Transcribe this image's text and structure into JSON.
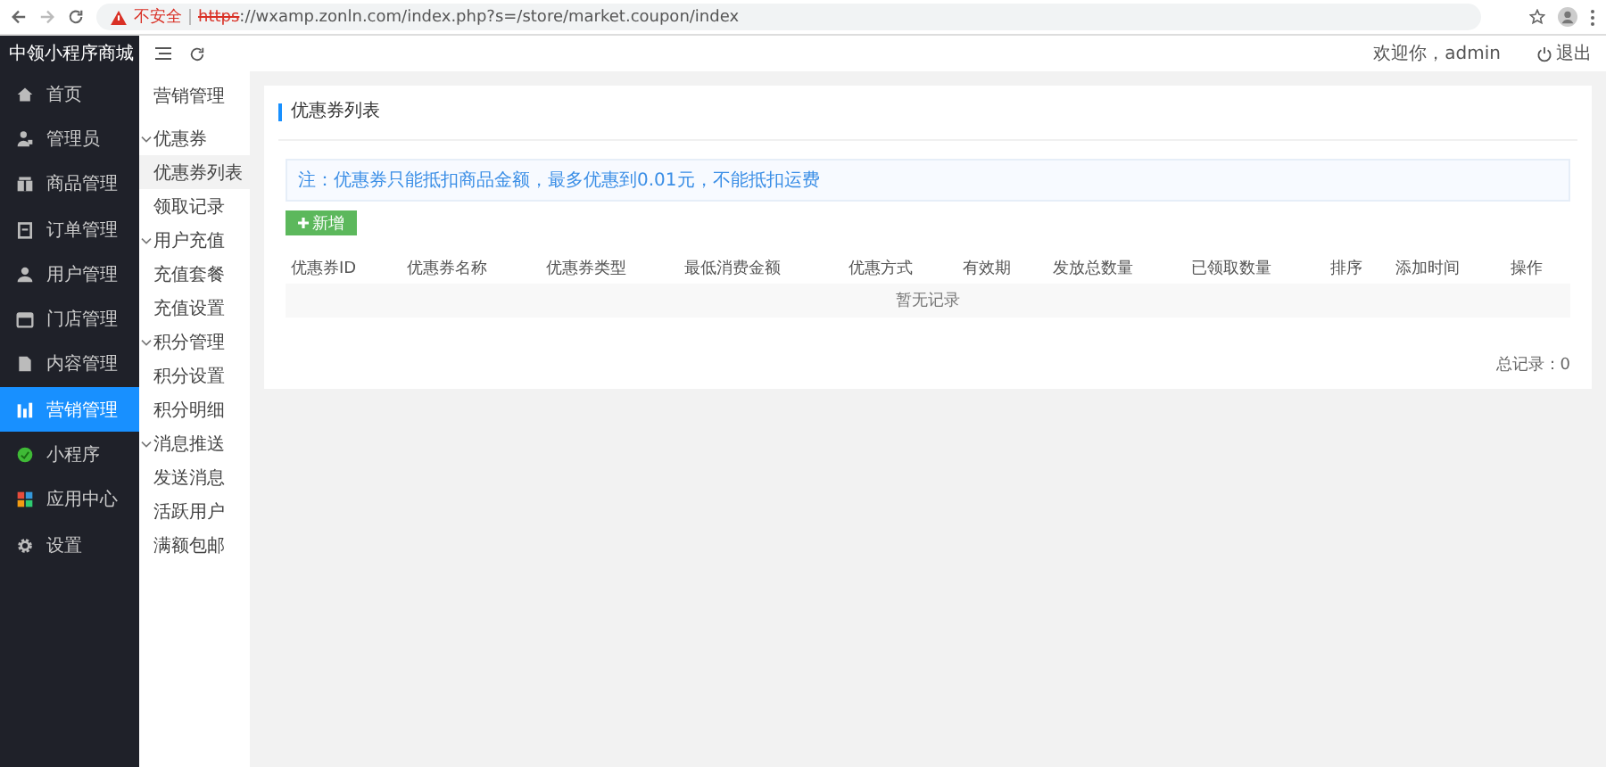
{
  "browser": {
    "security": "不安全",
    "url_scheme": "https",
    "url_rest": "://wxamp.zonln.com/index.php?s=/store/market.coupon/index"
  },
  "sidebar": {
    "title": "中领小程序商城",
    "items": [
      {
        "label": "首页",
        "selected": false
      },
      {
        "label": "管理员",
        "selected": false
      },
      {
        "label": "商品管理",
        "selected": false
      },
      {
        "label": "订单管理",
        "selected": false
      },
      {
        "label": "用户管理",
        "selected": false
      },
      {
        "label": "门店管理",
        "selected": false
      },
      {
        "label": "内容管理",
        "selected": false
      },
      {
        "label": "营销管理",
        "selected": true
      },
      {
        "label": "小程序",
        "selected": false
      },
      {
        "label": "应用中心",
        "selected": false
      },
      {
        "label": "设置",
        "selected": false
      }
    ]
  },
  "submenu": {
    "title": "营销管理",
    "items": [
      {
        "kind": "group",
        "label": "优惠券",
        "expanded": true,
        "children": [
          {
            "label": "优惠券列表",
            "selected": true
          },
          {
            "label": "领取记录",
            "selected": false
          }
        ]
      },
      {
        "kind": "group",
        "label": "用户充值",
        "expanded": true,
        "children": [
          {
            "label": "充值套餐",
            "selected": false
          },
          {
            "label": "充值设置",
            "selected": false
          }
        ]
      },
      {
        "kind": "group",
        "label": "积分管理",
        "expanded": true,
        "children": [
          {
            "label": "积分设置",
            "selected": false
          },
          {
            "label": "积分明细",
            "selected": false
          }
        ]
      },
      {
        "kind": "group",
        "label": "消息推送",
        "expanded": true,
        "children": [
          {
            "label": "发送消息",
            "selected": false
          },
          {
            "label": "活跃用户",
            "selected": false
          }
        ]
      },
      {
        "kind": "link",
        "label": "满额包邮",
        "selected": false
      }
    ]
  },
  "header": {
    "welcome": "欢迎你，admin",
    "logout": "退出"
  },
  "panel": {
    "title": "优惠券列表",
    "notice": "注：优惠券只能抵扣商品金额，最多优惠到0.01元，不能抵扣运费",
    "add_button": "新增",
    "table": {
      "columns": [
        "优惠券ID",
        "优惠券名称",
        "优惠券类型",
        "最低消费金额",
        "优惠方式",
        "有效期",
        "发放总数量",
        "已领取数量",
        "排序",
        "添加时间",
        "操作"
      ],
      "empty": "暂无记录"
    },
    "total": "总记录：0"
  }
}
